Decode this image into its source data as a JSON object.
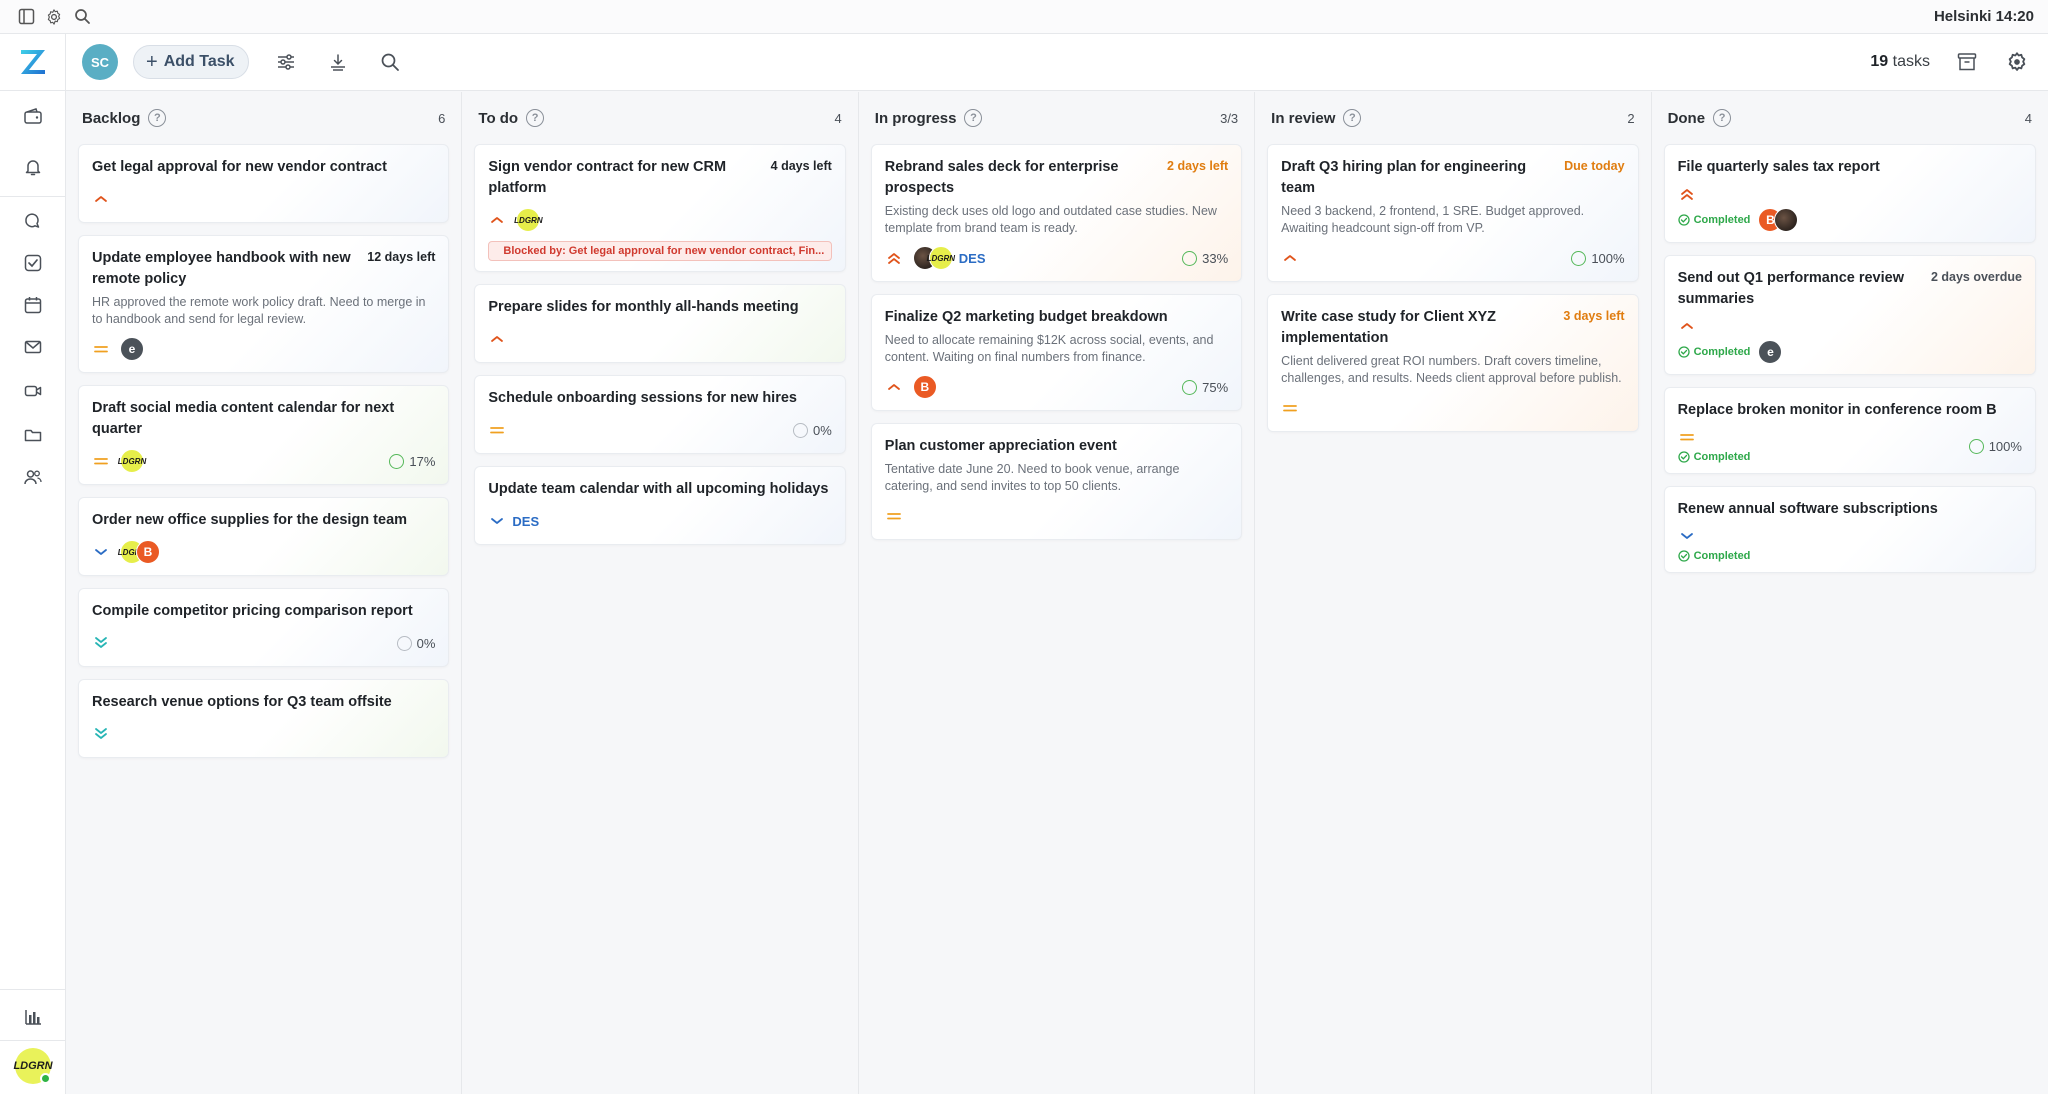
{
  "topbar": {
    "icons": [
      "sidebar-toggle-icon",
      "gear-icon",
      "search-icon"
    ],
    "clock": "Helsinki 14:20"
  },
  "sidebar": {
    "icons": [
      "wallet-icon",
      "bell-icon",
      "chat-icon",
      "checkbox-icon",
      "calendar-icon",
      "mail-icon",
      "video-icon",
      "folder-icon",
      "users-icon",
      "stats-icon"
    ],
    "user_avatar_text": "LDGRN"
  },
  "toolbar": {
    "avatar_initials": "SC",
    "add_task_label": "Add Task",
    "task_count_number": "19",
    "task_count_suffix": "tasks"
  },
  "colors": {
    "accent": "#2b6cc4",
    "high": "#e0541c",
    "medium": "#f0a020",
    "low": "#2b6cc4",
    "lowest": "#27b5b5",
    "completed": "#2ea84a",
    "blocked": "#d03a2f"
  },
  "columns": [
    {
      "title": "Backlog",
      "count": "6",
      "cards": [
        {
          "title": "Get legal approval for new vendor contract",
          "priority": "high",
          "style": "plain"
        },
        {
          "title": "Update employee handbook with new remote policy",
          "due": "12 days left",
          "due_style": "dark",
          "desc": "HR approved the remote work policy draft. Need to merge in to handbook and send for legal review.",
          "priority": "medium",
          "avatars": [
            {
              "text": "e",
              "style": "dark"
            }
          ],
          "style": "plain"
        },
        {
          "title": "Draft social media content calendar for next quarter",
          "priority": "medium",
          "avatars": [
            {
              "text": "LDGRN",
              "style": "yellow"
            }
          ],
          "progress": "17%",
          "ring": "green",
          "style": "green"
        },
        {
          "title": "Order new office supplies for the design team",
          "priority": "low",
          "avatars": [
            {
              "text": "LDGRN",
              "style": "yellow"
            },
            {
              "text": "B",
              "style": "orange"
            }
          ],
          "style": "green"
        },
        {
          "title": "Compile competitor pricing comparison report",
          "priority": "lowest",
          "progress": "0%",
          "ring": "gray",
          "style": "plain"
        },
        {
          "title": "Research venue options for Q3 team offsite",
          "priority": "lowest",
          "style": "green"
        }
      ]
    },
    {
      "title": "To do",
      "count": "4",
      "cards": [
        {
          "title": "Sign vendor contract for new CRM platform",
          "due": "4 days left",
          "due_style": "dark",
          "priority": "high",
          "avatars": [
            {
              "text": "LDGRN",
              "style": "yellow"
            }
          ],
          "blocked": "Blocked by: Get legal approval for new vendor contract, Fin...",
          "style": "plain"
        },
        {
          "title": "Prepare slides for monthly all-hands meeting",
          "priority": "high",
          "style": "green"
        },
        {
          "title": "Schedule onboarding sessions for new hires",
          "priority": "medium",
          "progress": "0%",
          "ring": "gray",
          "style": "plain"
        },
        {
          "title": "Update team calendar with all upcoming holidays",
          "priority": "low",
          "tag": "DES",
          "style": "plain"
        }
      ]
    },
    {
      "title": "In progress",
      "count": "3/3",
      "cards": [
        {
          "title": "Rebrand sales deck for enterprise prospects",
          "due": "2 days left",
          "due_style": "orange",
          "desc": "Existing deck uses old logo and outdated case studies. New template from brand team is ready.",
          "priority": "highest",
          "avatars": [
            {
              "text": "",
              "style": "photo"
            },
            {
              "text": "LDGRN",
              "style": "yellow"
            }
          ],
          "tag": "DES",
          "progress": "33%",
          "ring": "green",
          "style": "warm"
        },
        {
          "title": "Finalize Q2 marketing budget breakdown",
          "desc": "Need to allocate remaining $12K across social, events, and content. Waiting on final numbers from finance.",
          "priority": "high",
          "avatars": [
            {
              "text": "B",
              "style": "orange"
            }
          ],
          "progress": "75%",
          "ring": "green",
          "style": "plain"
        },
        {
          "title": "Plan customer appreciation event",
          "desc": "Tentative date June 20. Need to book venue, arrange catering, and send invites to top 50 clients.",
          "priority": "medium",
          "style": "plain"
        }
      ]
    },
    {
      "title": "In review",
      "count": "2",
      "cards": [
        {
          "title": "Draft Q3 hiring plan for engineering team",
          "due": "Due today",
          "due_style": "orange",
          "desc": "Need 3 backend, 2 frontend, 1 SRE. Budget approved. Awaiting headcount sign-off from VP.",
          "priority": "high",
          "progress": "100%",
          "ring": "green",
          "style": "plain"
        },
        {
          "title": "Write case study for Client XYZ implementation",
          "due": "3 days left",
          "due_style": "orange",
          "desc": "Client delivered great ROI numbers. Draft covers timeline, challenges, and results. Needs client approval before publish.",
          "priority": "medium",
          "style": "warm"
        }
      ]
    },
    {
      "title": "Done",
      "count": "4",
      "cards": [
        {
          "title": "File quarterly sales tax report",
          "priority": "highest",
          "completed": "Completed",
          "avatars": [
            {
              "text": "B",
              "style": "orange"
            },
            {
              "text": "",
              "style": "photo"
            }
          ],
          "style": "plain"
        },
        {
          "title": "Send out Q1 performance review summaries",
          "due": "2 days overdue",
          "due_style": "gray",
          "priority": "high",
          "completed": "Completed",
          "avatars": [
            {
              "text": "e",
              "style": "dark"
            }
          ],
          "style": "warm"
        },
        {
          "title": "Replace broken monitor in conference room B",
          "priority": "medium",
          "completed": "Completed",
          "progress": "100%",
          "ring": "green",
          "style": "plain"
        },
        {
          "title": "Renew annual software subscriptions",
          "priority": "low",
          "completed": "Completed",
          "style": "plain"
        }
      ]
    }
  ]
}
